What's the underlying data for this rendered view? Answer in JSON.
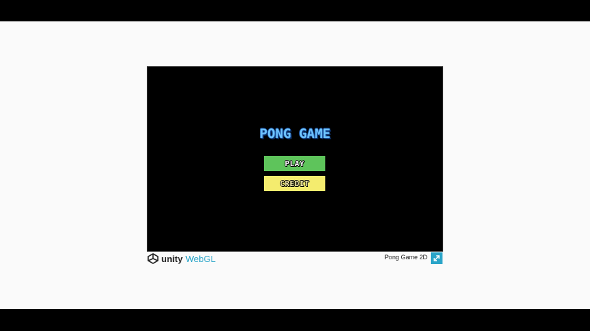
{
  "game": {
    "title": "PONG GAME",
    "buttons": {
      "play_label": "PLAY",
      "credit_label": "CREDIT"
    }
  },
  "footer": {
    "unity_label": "unity",
    "webgl_label": "WebGL",
    "build_title": "Pong Game 2D",
    "fullscreen_icon": "fullscreen-icon"
  },
  "colors": {
    "title": "#6ec3ff",
    "play_button": "#5ec45b",
    "credit_button": "#f4ec6e",
    "webgl_accent": "#29a4c8",
    "canvas_background": "#000000",
    "page_background": "#fafafa"
  }
}
